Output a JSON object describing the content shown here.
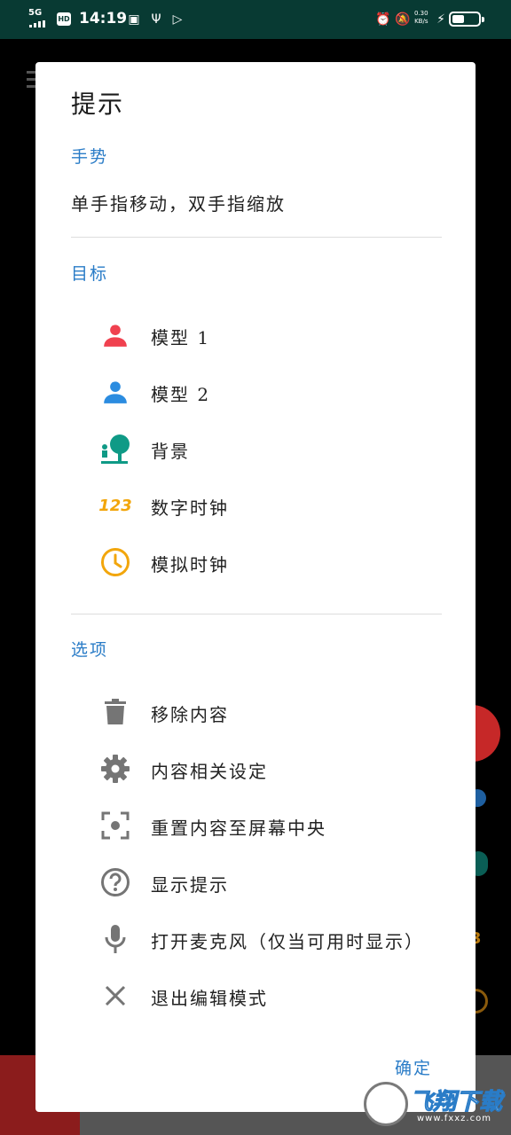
{
  "status_bar": {
    "network": "5G",
    "hd": "HD",
    "time": "14:19",
    "speed_value": "0.30",
    "speed_unit": "KB/s"
  },
  "dialog": {
    "title": "提示",
    "gesture_section": "手势",
    "gesture_text": "单手指移动，双手指缩放",
    "target_section": "目标",
    "targets": [
      {
        "label": "模型 1",
        "icon": "person-icon",
        "color": "#f0414f"
      },
      {
        "label": "模型 2",
        "icon": "person-icon",
        "color": "#2b8ce0"
      },
      {
        "label": "背景",
        "icon": "tree-person-icon",
        "color": "#0f9a86"
      },
      {
        "label": "数字时钟",
        "icon": "digital-clock-icon",
        "icon_text": "123",
        "color": "#f2a60c"
      },
      {
        "label": "模拟时钟",
        "icon": "analog-clock-icon",
        "color": "#f2a60c"
      }
    ],
    "options_section": "选项",
    "options": [
      {
        "label": "移除内容",
        "icon": "trash-icon"
      },
      {
        "label": "内容相关设定",
        "icon": "gear-icon"
      },
      {
        "label": "重置内容至屏幕中央",
        "icon": "center-focus-icon"
      },
      {
        "label": "显示提示",
        "icon": "help-icon"
      },
      {
        "label": "打开麦克风（仅当可用时显示）",
        "icon": "microphone-icon"
      },
      {
        "label": "退出编辑模式",
        "icon": "close-icon"
      }
    ],
    "ok_button": "确定"
  },
  "watermark": {
    "text": "飞翔下载",
    "url": "www.fxxz.com"
  }
}
